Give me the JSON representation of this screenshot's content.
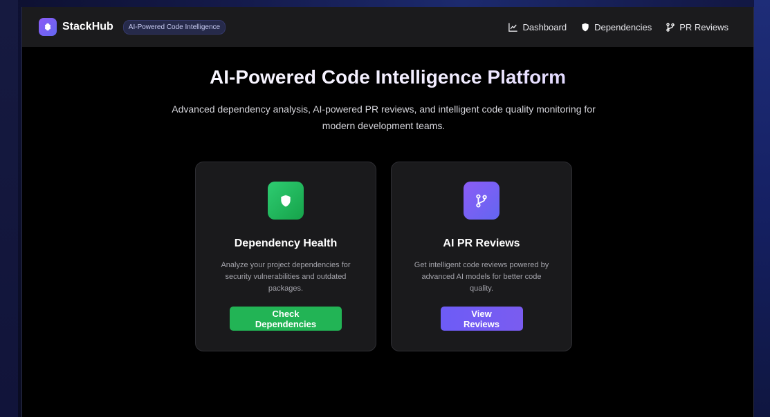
{
  "header": {
    "brand": "StackHub",
    "badge": "AI-Powered Code Intelligence",
    "nav": [
      {
        "label": "Dashboard",
        "icon": "chart-line-icon"
      },
      {
        "label": "Dependencies",
        "icon": "shield-icon"
      },
      {
        "label": "PR Reviews",
        "icon": "git-branch-icon"
      }
    ]
  },
  "hero": {
    "title": "AI-Powered Code Intelligence Platform",
    "subtitle": "Advanced dependency analysis, AI-powered PR reviews, and intelligent code quality monitoring for modern development teams."
  },
  "cards": [
    {
      "title": "Dependency Health",
      "description": "Analyze your project dependencies for security vulnerabilities and outdated packages.",
      "button": "Check Dependencies",
      "icon": "shield-icon",
      "accent": "#22b455"
    },
    {
      "title": "AI PR Reviews",
      "description": "Get intelligent code reviews powered by advanced AI models for better code quality.",
      "button": "View Reviews",
      "icon": "git-branch-icon",
      "accent": "#6d5cf6"
    }
  ]
}
